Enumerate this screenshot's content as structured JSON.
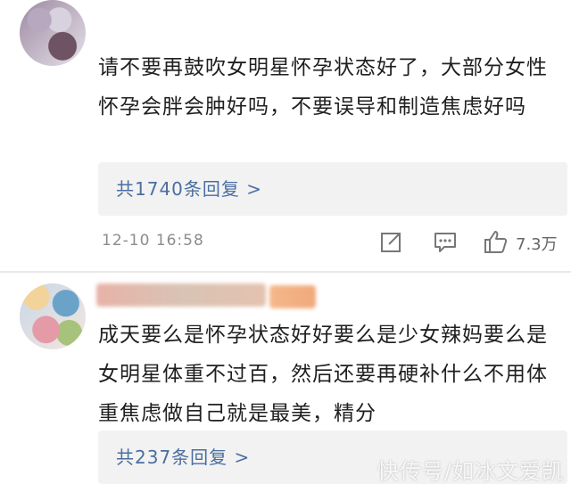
{
  "comments": [
    {
      "text": "请不要再鼓吹女明星怀孕状态好了，大部分女性怀孕会胖会肿好吗，不要误导和制造焦虑好吗",
      "replies_label": "共1740条回复 >",
      "time": "12-10 16:58",
      "likes": "7.3万"
    },
    {
      "text": "成天要么是怀孕状态好好要么是少女辣妈要么是女明星体重不过百，然后还要再硬补什么不用体重焦虑做自己就是最美，精分",
      "replies_label": "共237条回复 >"
    }
  ],
  "icons": {
    "share": "share-icon",
    "comment": "comment-icon",
    "like": "like-icon"
  },
  "watermark": "快传号/如冰文爱凯"
}
